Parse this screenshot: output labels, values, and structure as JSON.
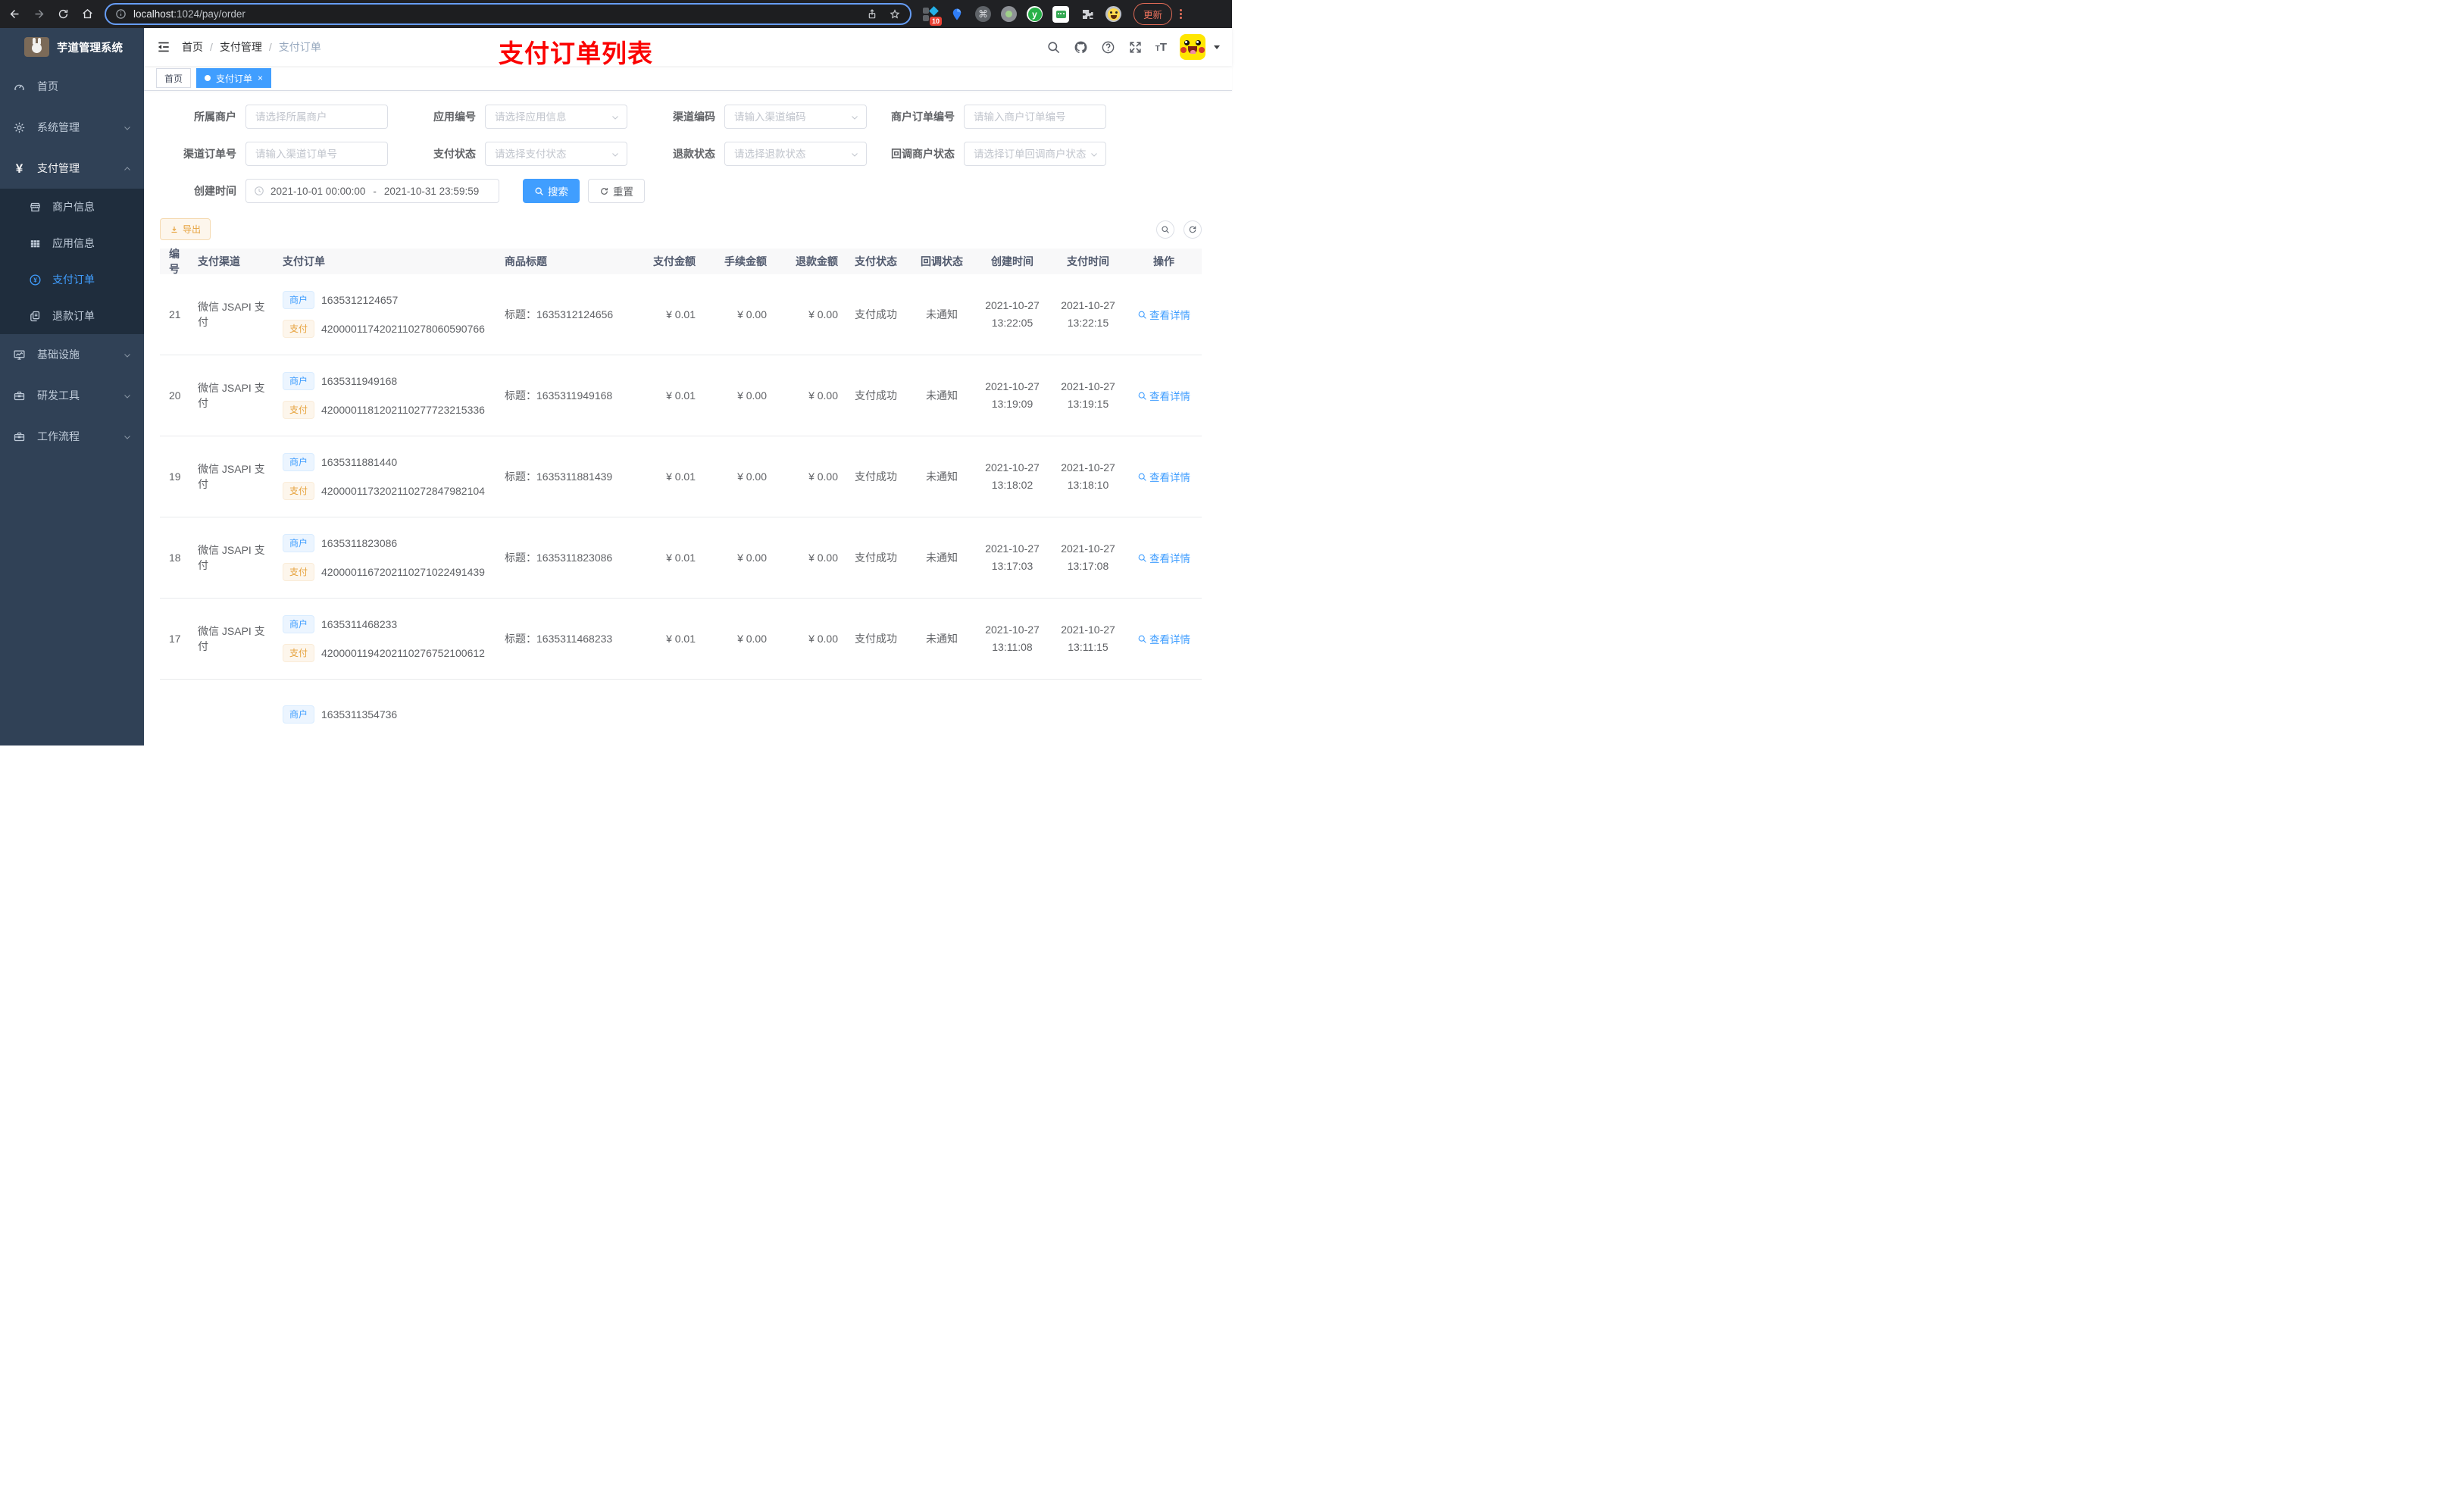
{
  "browser": {
    "url_host": "localhost",
    "url_path": ":1024/pay/order",
    "badge": "10",
    "cmd_glyph": "⌘",
    "y_glyph": "y",
    "update_label": "更新"
  },
  "sidebar": {
    "title": "芋道管理系统",
    "menu": [
      {
        "label": "首页"
      },
      {
        "label": "系统管理"
      },
      {
        "label": "支付管理"
      },
      {
        "label": "基础设施"
      },
      {
        "label": "研发工具"
      },
      {
        "label": "工作流程"
      }
    ],
    "submenu": [
      {
        "label": "商户信息"
      },
      {
        "label": "应用信息"
      },
      {
        "label": "支付订单"
      },
      {
        "label": "退款订单"
      }
    ],
    "yen_glyph": "¥"
  },
  "header": {
    "breadcrumb": [
      "首页",
      "支付管理",
      "支付订单"
    ],
    "separator": "/",
    "annotation": "支付订单列表",
    "tabs": [
      {
        "label": "首页"
      },
      {
        "label": "支付订单"
      }
    ],
    "tab_close": "×",
    "font_small": "T",
    "font_big": "T"
  },
  "filters": {
    "f1": {
      "label": "所属商户",
      "ph": "请选择所属商户"
    },
    "f2": {
      "label": "应用编号",
      "ph": "请选择应用信息"
    },
    "f3": {
      "label": "渠道编码",
      "ph": "请输入渠道编码"
    },
    "f4": {
      "label": "商户订单编号",
      "ph": "请输入商户订单编号"
    },
    "f5": {
      "label": "渠道订单号",
      "ph": "请输入渠道订单号"
    },
    "f6": {
      "label": "支付状态",
      "ph": "请选择支付状态"
    },
    "f7": {
      "label": "退款状态",
      "ph": "请选择退款状态"
    },
    "f8": {
      "label": "回调商户状态",
      "ph": "请选择订单回调商户状态"
    },
    "time": {
      "label": "创建时间",
      "start": "2021-10-01 00:00:00",
      "dash": "-",
      "end": "2021-10-31 23:59:59"
    },
    "search": "搜索",
    "reset": "重置"
  },
  "toolbar": {
    "export_label": "导出"
  },
  "table": {
    "headers": [
      "编号",
      "支付渠道",
      "支付订单",
      "商品标题",
      "支付金额",
      "手续金额",
      "退款金额",
      "支付状态",
      "回调状态",
      "创建时间",
      "支付时间",
      "操作"
    ],
    "tag_merchant": "商户",
    "tag_pay": "支付",
    "action_label": "查看详情",
    "rows": [
      {
        "id": "21",
        "channel": "微信 JSAPI 支付",
        "merchant_no": "1635312124657",
        "pay_no": "4200001174202110278060590766",
        "title": "标题：1635312124656",
        "amount": "¥ 0.01",
        "fee": "¥ 0.00",
        "refund": "¥ 0.00",
        "status": "支付成功",
        "notify": "未通知",
        "created_date": "2021-10-27",
        "created_time": "13:22:05",
        "pay_date": "2021-10-27",
        "pay_time": "13:22:15"
      },
      {
        "id": "20",
        "channel": "微信 JSAPI 支付",
        "merchant_no": "1635311949168",
        "pay_no": "4200001181202110277723215336",
        "title": "标题：1635311949168",
        "amount": "¥ 0.01",
        "fee": "¥ 0.00",
        "refund": "¥ 0.00",
        "status": "支付成功",
        "notify": "未通知",
        "created_date": "2021-10-27",
        "created_time": "13:19:09",
        "pay_date": "2021-10-27",
        "pay_time": "13:19:15"
      },
      {
        "id": "19",
        "channel": "微信 JSAPI 支付",
        "merchant_no": "1635311881440",
        "pay_no": "4200001173202110272847982104",
        "title": "标题：1635311881439",
        "amount": "¥ 0.01",
        "fee": "¥ 0.00",
        "refund": "¥ 0.00",
        "status": "支付成功",
        "notify": "未通知",
        "created_date": "2021-10-27",
        "created_time": "13:18:02",
        "pay_date": "2021-10-27",
        "pay_time": "13:18:10"
      },
      {
        "id": "18",
        "channel": "微信 JSAPI 支付",
        "merchant_no": "1635311823086",
        "pay_no": "4200001167202110271022491439",
        "title": "标题：1635311823086",
        "amount": "¥ 0.01",
        "fee": "¥ 0.00",
        "refund": "¥ 0.00",
        "status": "支付成功",
        "notify": "未通知",
        "created_date": "2021-10-27",
        "created_time": "13:17:03",
        "pay_date": "2021-10-27",
        "pay_time": "13:17:08"
      },
      {
        "id": "17",
        "channel": "微信 JSAPI 支付",
        "merchant_no": "1635311468233",
        "pay_no": "4200001194202110276752100612",
        "title": "标题：1635311468233",
        "amount": "¥ 0.01",
        "fee": "¥ 0.00",
        "refund": "¥ 0.00",
        "status": "支付成功",
        "notify": "未通知",
        "created_date": "2021-10-27",
        "created_time": "13:11:08",
        "pay_date": "2021-10-27",
        "pay_time": "13:11:15"
      },
      {
        "id": "",
        "channel": "",
        "merchant_no": "1635311354736",
        "pay_no": "",
        "title": "",
        "amount": "",
        "fee": "",
        "refund": "",
        "status": "",
        "notify": "",
        "created_date": "",
        "created_time": "",
        "pay_date": "",
        "pay_time": ""
      }
    ]
  },
  "colors": {
    "accent": "#409EFF",
    "warning": "#E6A23C",
    "annotation": "#FB0100",
    "sidebar_bg": "#304156",
    "submenu_bg": "#1F2D3D"
  }
}
